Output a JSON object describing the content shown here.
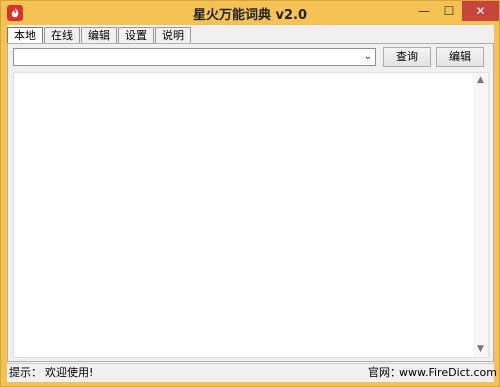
{
  "window": {
    "title": "星火万能词典 v2.0",
    "minimize_glyph": "—",
    "maximize_glyph": "☐",
    "close_glyph": "✕"
  },
  "tabs": [
    {
      "label": "本地",
      "active": true
    },
    {
      "label": "在线",
      "active": false
    },
    {
      "label": "编辑",
      "active": false
    },
    {
      "label": "设置",
      "active": false
    },
    {
      "label": "说明",
      "active": false
    }
  ],
  "search": {
    "value": "",
    "dropdown_glyph": "⌄",
    "query_label": "查询",
    "edit_label": "编辑"
  },
  "result": {
    "scroll_up_glyph": "▲",
    "scroll_down_glyph": "▼"
  },
  "status": {
    "label": "提示：",
    "message": "欢迎使用!",
    "site_label": "官网：",
    "site_url": "www.FireDict.com"
  },
  "colors": {
    "title_bar": "#f4c255",
    "close_button": "#c7453a",
    "app_icon": "#d8352a"
  }
}
